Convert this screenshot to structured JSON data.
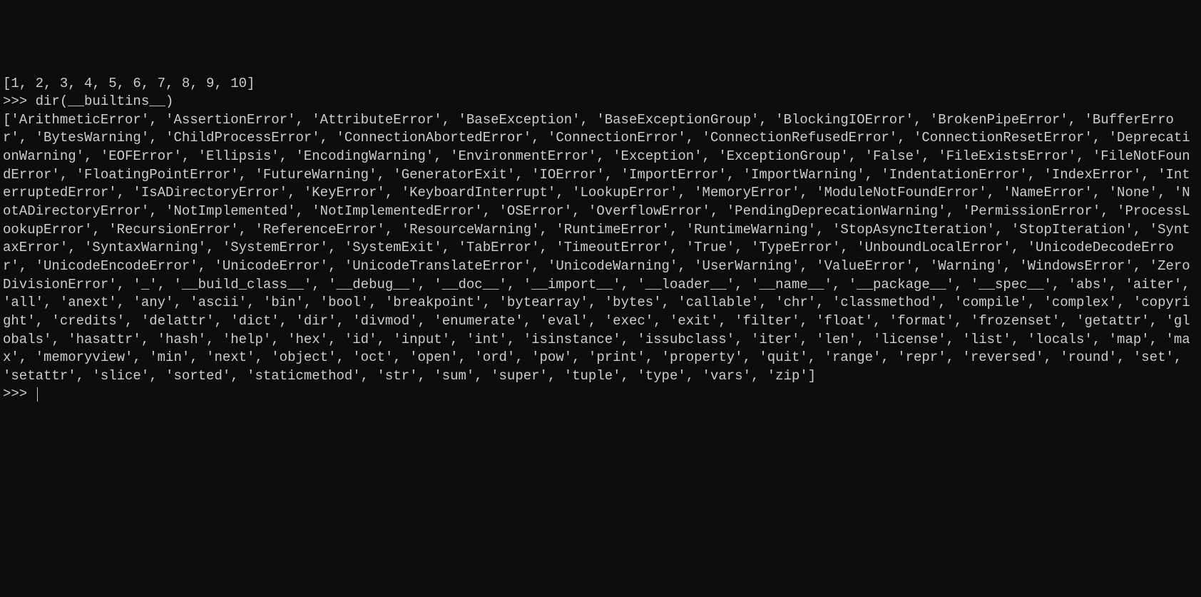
{
  "terminal": {
    "line0": "[1, 2, 3, 4, 5, 6, 7, 8, 9, 10]",
    "prompt": ">>> ",
    "command": "dir(__builtins__)",
    "output": "['ArithmeticError', 'AssertionError', 'AttributeError', 'BaseException', 'BaseExceptionGroup', 'BlockingIOError', 'BrokenPipeError', 'BufferError', 'BytesWarning', 'ChildProcessError', 'ConnectionAbortedError', 'ConnectionError', 'ConnectionRefusedError', 'ConnectionResetError', 'DeprecationWarning', 'EOFError', 'Ellipsis', 'EncodingWarning', 'EnvironmentError', 'Exception', 'ExceptionGroup', 'False', 'FileExistsError', 'FileNotFoundError', 'FloatingPointError', 'FutureWarning', 'GeneratorExit', 'IOError', 'ImportError', 'ImportWarning', 'IndentationError', 'IndexError', 'InterruptedError', 'IsADirectoryError', 'KeyError', 'KeyboardInterrupt', 'LookupError', 'MemoryError', 'ModuleNotFoundError', 'NameError', 'None', 'NotADirectoryError', 'NotImplemented', 'NotImplementedError', 'OSError', 'OverflowError', 'PendingDeprecationWarning', 'PermissionError', 'ProcessLookupError', 'RecursionError', 'ReferenceError', 'ResourceWarning', 'RuntimeError', 'RuntimeWarning', 'StopAsyncIteration', 'StopIteration', 'SyntaxError', 'SyntaxWarning', 'SystemError', 'SystemExit', 'TabError', 'TimeoutError', 'True', 'TypeError', 'UnboundLocalError', 'UnicodeDecodeError', 'UnicodeEncodeError', 'UnicodeError', 'UnicodeTranslateError', 'UnicodeWarning', 'UserWarning', 'ValueError', 'Warning', 'WindowsError', 'ZeroDivisionError', '_', '__build_class__', '__debug__', '__doc__', '__import__', '__loader__', '__name__', '__package__', '__spec__', 'abs', 'aiter', 'all', 'anext', 'any', 'ascii', 'bin', 'bool', 'breakpoint', 'bytearray', 'bytes', 'callable', 'chr', 'classmethod', 'compile', 'complex', 'copyright', 'credits', 'delattr', 'dict', 'dir', 'divmod', 'enumerate', 'eval', 'exec', 'exit', 'filter', 'float', 'format', 'frozenset', 'getattr', 'globals', 'hasattr', 'hash', 'help', 'hex', 'id', 'input', 'int', 'isinstance', 'issubclass', 'iter', 'len', 'license', 'list', 'locals', 'map', 'max', 'memoryview', 'min', 'next', 'object', 'oct', 'open', 'ord', 'pow', 'print', 'property', 'quit', 'range', 'repr', 'reversed', 'round', 'set', 'setattr', 'slice', 'sorted', 'staticmethod', 'str', 'sum', 'super', 'tuple', 'type', 'vars', 'zip']",
    "prompt2": ">>> "
  }
}
